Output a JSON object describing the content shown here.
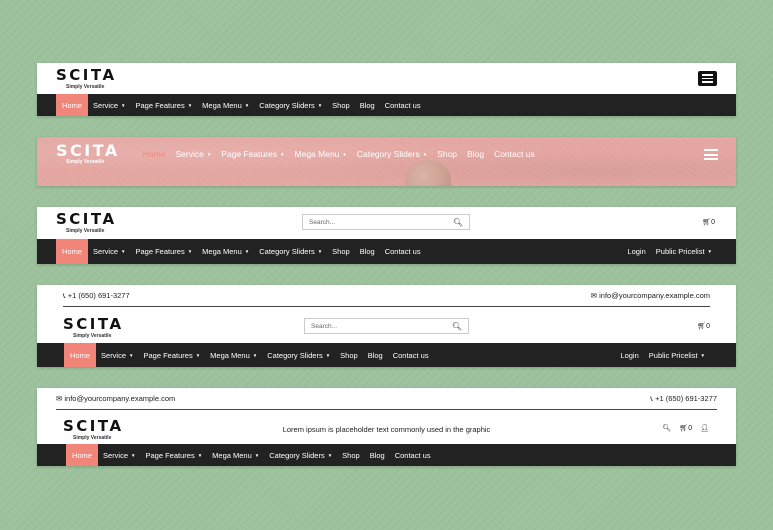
{
  "brand": {
    "name": "SCITA",
    "tagline": "Simply Versatile"
  },
  "nav": {
    "home": "Home",
    "service": "Service",
    "page_features": "Page Features",
    "mega_menu": "Mega Menu",
    "category_sliders": "Category Sliders",
    "shop": "Shop",
    "blog": "Blog",
    "contact": "Contact us",
    "login": "Login",
    "pricelist": "Public Pricelist"
  },
  "search": {
    "placeholder": "Search..."
  },
  "cart": {
    "count": "0"
  },
  "contact": {
    "phone": "+1 (650) 691-3277",
    "email": "info@yourcompany.example.com"
  },
  "header5": {
    "text": "Lorem ipsum is placeholder text commonly used in the graphic"
  },
  "colors": {
    "background": "#9dc29d",
    "navbar": "#222222",
    "accent": "#f2857a",
    "transparent_header": "#e4a6a1"
  }
}
